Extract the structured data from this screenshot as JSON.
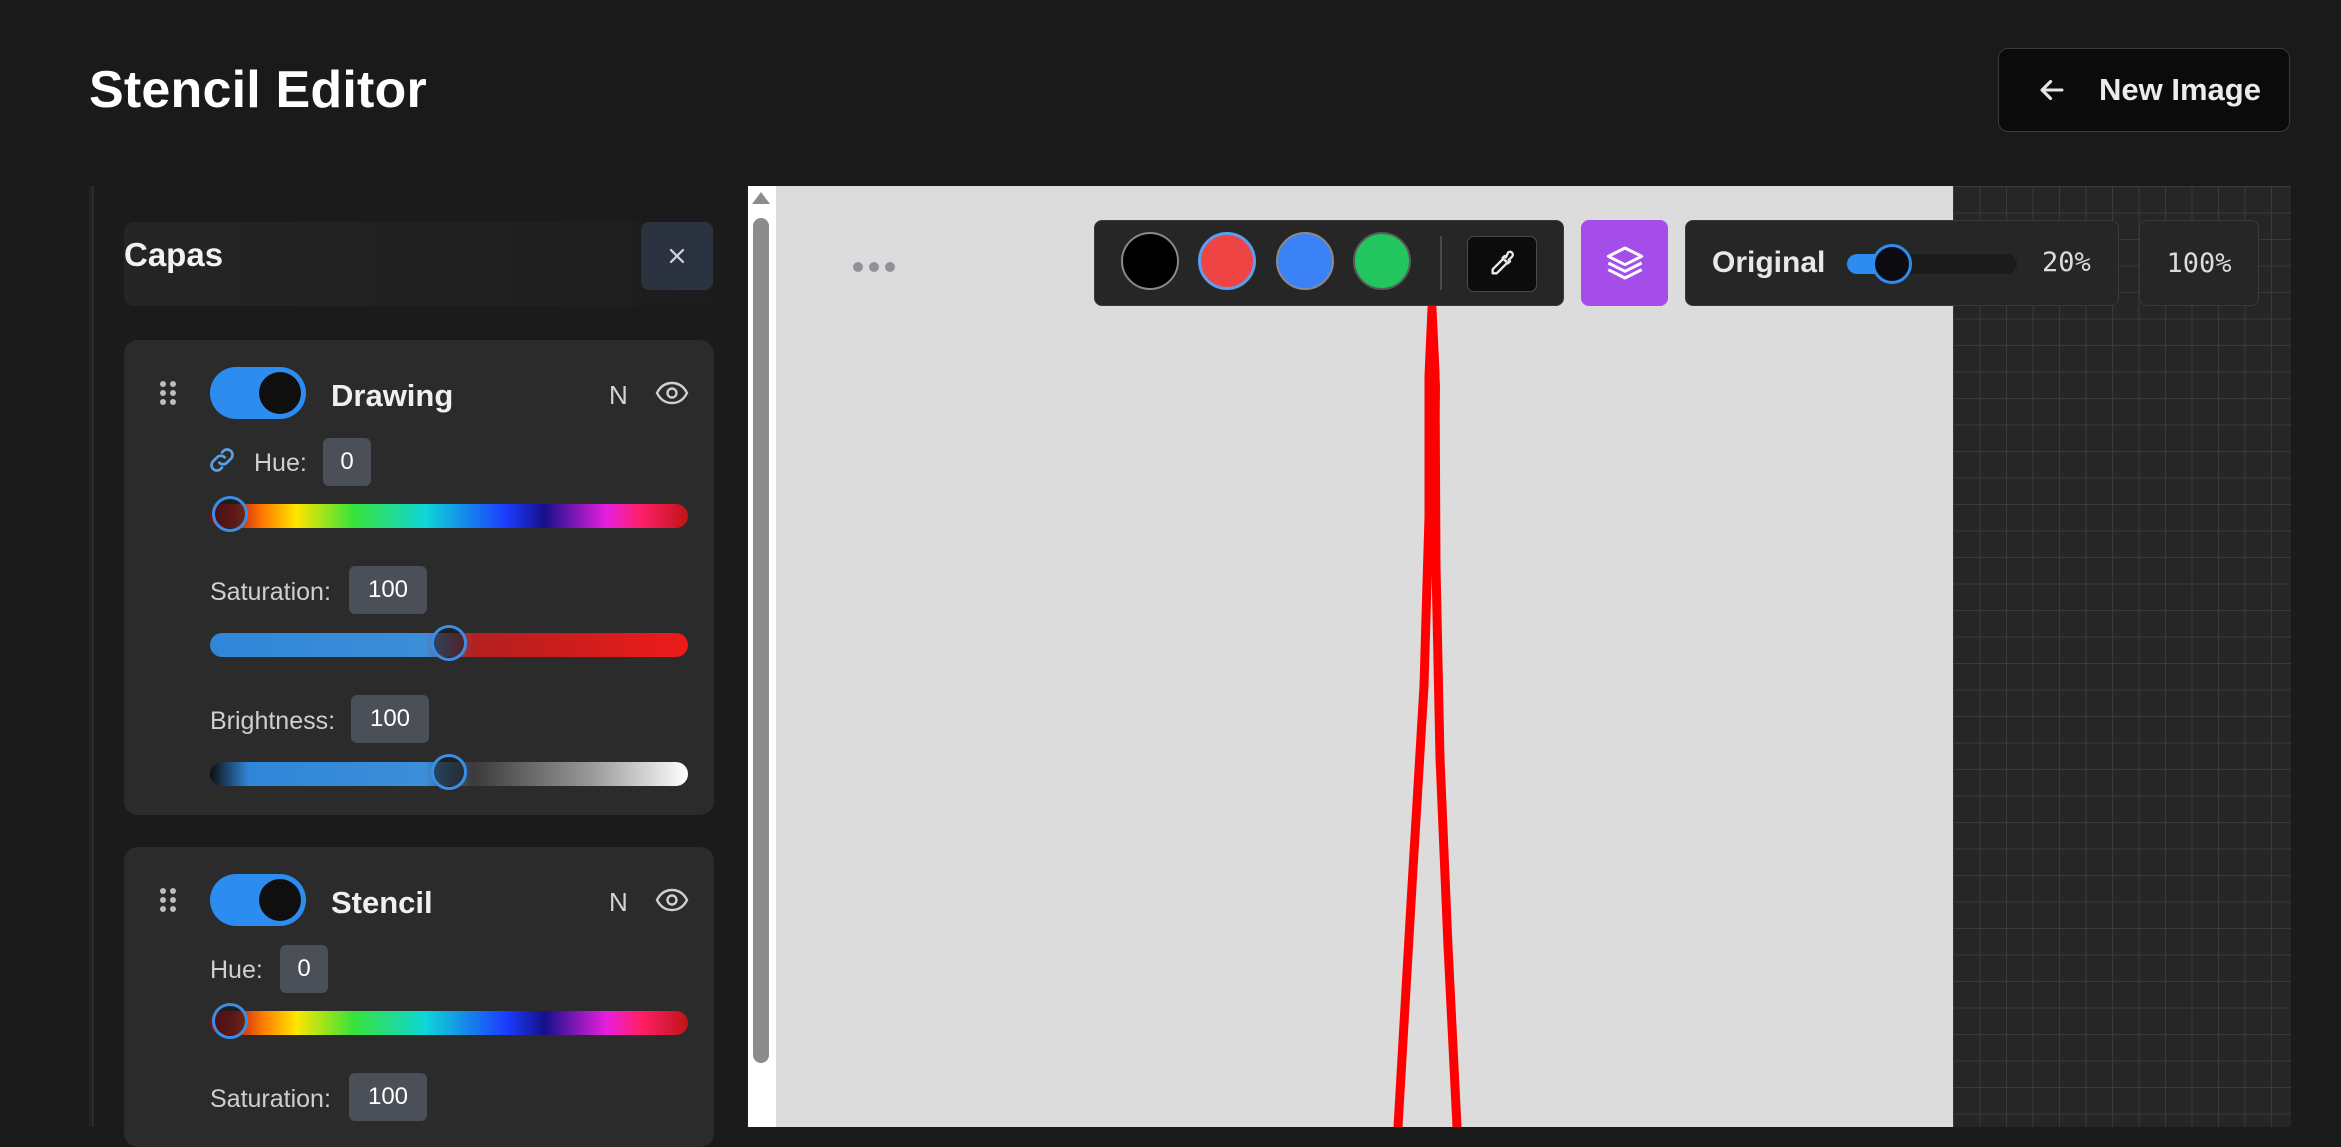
{
  "app": {
    "title": "Stencil Editor"
  },
  "header": {
    "new_image_label": "New Image"
  },
  "layers_panel": {
    "title": "Capas",
    "layers": [
      {
        "name": "Drawing",
        "enabled": true,
        "blend": "N",
        "hue": {
          "label": "Hue:",
          "value": "0"
        },
        "saturation": {
          "label": "Saturation:",
          "value": "100"
        },
        "brightness": {
          "label": "Brightness:",
          "value": "100"
        }
      },
      {
        "name": "Stencil",
        "enabled": true,
        "blend": "N",
        "hue": {
          "label": "Hue:",
          "value": "0"
        },
        "saturation": {
          "label": "Saturation:",
          "value": "100"
        }
      }
    ]
  },
  "toolbar": {
    "colors": [
      {
        "name": "black",
        "hex": "#000000"
      },
      {
        "name": "red",
        "hex": "#ef4444",
        "selected": true
      },
      {
        "name": "blue",
        "hex": "#3b82f6"
      },
      {
        "name": "green",
        "hex": "#22c55e"
      }
    ],
    "eyedropper_icon": "eyedropper-icon",
    "layers_icon": "layers-icon",
    "layers_button_color": "#a44de8"
  },
  "overlay": {
    "label": "Original",
    "opacity_value": "20%",
    "opacity_fraction": 0.2
  },
  "zoom": {
    "label": "100%"
  },
  "colors": {
    "accent": "#2d8cf0",
    "stroke": "#ff0000"
  }
}
